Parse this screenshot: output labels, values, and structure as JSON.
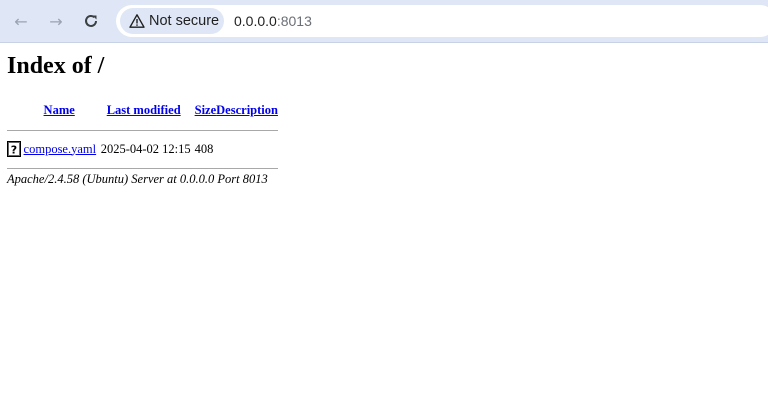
{
  "browser": {
    "security_label": "Not secure",
    "url_host": "0.0.0.0",
    "url_port": ":8013"
  },
  "page": {
    "title": "Index of /",
    "columns": {
      "name": "Name",
      "last_modified": "Last modified",
      "size": "Size",
      "description": "Description"
    },
    "files": [
      {
        "name": "compose.yaml",
        "last_modified": "2025-04-02 12:15",
        "size": "408",
        "description": ""
      }
    ],
    "server_signature": "Apache/2.4.58 (Ubuntu) Server at 0.0.0.0 Port 8013"
  }
}
